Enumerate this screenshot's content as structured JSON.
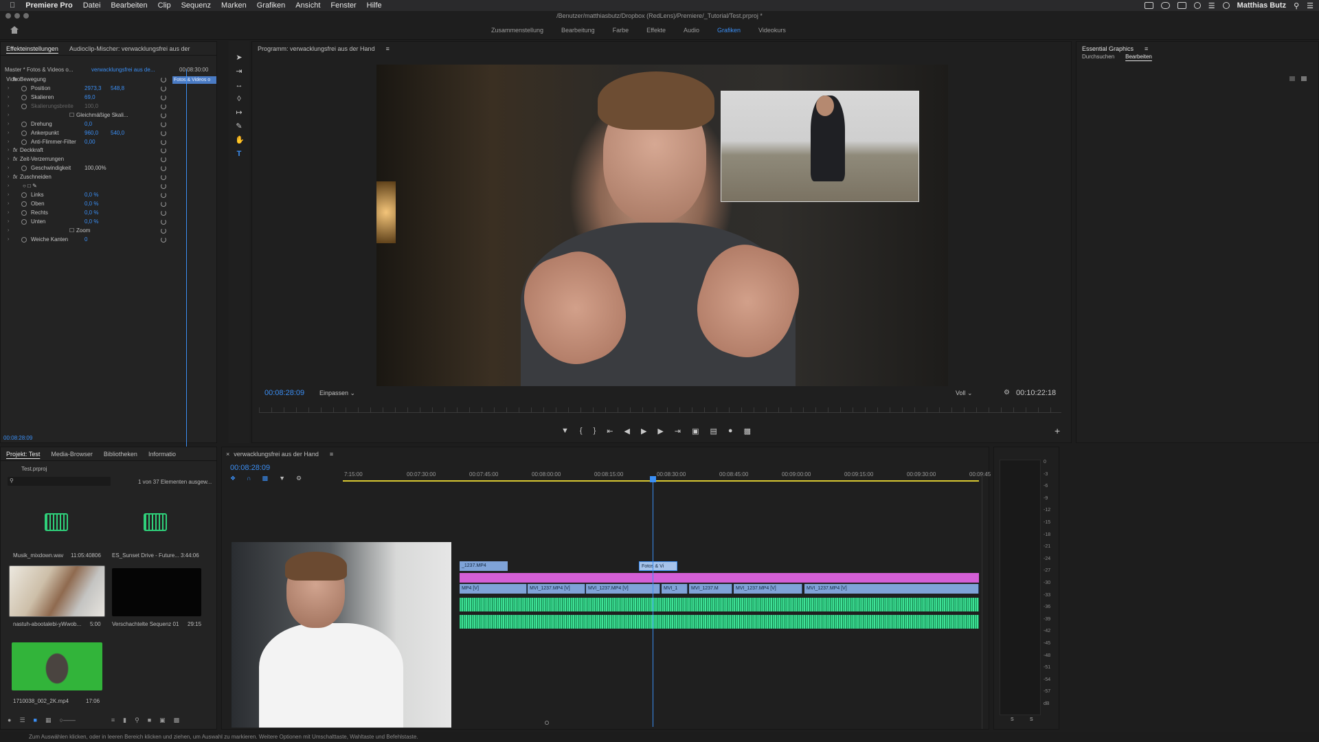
{
  "menubar": {
    "app": "Premiere Pro",
    "items": [
      "Datei",
      "Bearbeiten",
      "Clip",
      "Sequenz",
      "Marken",
      "Grafiken",
      "Ansicht",
      "Fenster",
      "Hilfe"
    ],
    "user": "Matthias Butz"
  },
  "titlebar": {
    "path": "/Benutzer/matthiasbutz/Dropbox (RedLens)/Premiere/_Tutorial/Test.prproj *"
  },
  "workspaces": {
    "tabs": [
      "Zusammenstellung",
      "Bearbeitung",
      "Farbe",
      "Effekte",
      "Audio",
      "Grafiken",
      "Videokurs"
    ],
    "active": "Grafiken"
  },
  "effects_panel": {
    "tabs": [
      "Effekteinstellungen",
      "Audioclip-Mischer: verwacklungsfrei aus der"
    ],
    "master": "Master * Fotos & Videos o...",
    "sequence": "verwacklungsfrei aus de...",
    "header_time": "00:08:30:00",
    "clip_label": "Fotos & Videos o",
    "section": "Video",
    "rows": [
      {
        "label": "Bewegung",
        "v1": "",
        "v2": "",
        "fx": true
      },
      {
        "label": "Position",
        "v1": "2973,3",
        "v2": "548,8"
      },
      {
        "label": "Skalieren",
        "v1": "69,0",
        "v2": ""
      },
      {
        "label": "Skalierungsbreite",
        "v1": "100,0",
        "v2": "",
        "dim": true
      },
      {
        "label": "Gleichmäßige Skali...",
        "v1": "",
        "v2": "",
        "checkbox": true
      },
      {
        "label": "Drehung",
        "v1": "0,0",
        "v2": ""
      },
      {
        "label": "Ankerpunkt",
        "v1": "960,0",
        "v2": "540,0"
      },
      {
        "label": "Anti-Flimmer-Filter",
        "v1": "0,00",
        "v2": ""
      },
      {
        "label": "Deckkraft",
        "v1": "",
        "v2": "",
        "fx": true
      },
      {
        "label": "Zeit-Verzerrungen",
        "v1": "",
        "v2": "",
        "fx": true
      },
      {
        "label": "Geschwindigkeit",
        "v1": "100,00%",
        "v2": "",
        "white": true
      },
      {
        "label": "Zuschneiden",
        "v1": "",
        "v2": "",
        "fx": true
      },
      {
        "label": "",
        "v1": "",
        "v2": "",
        "shapes": true
      },
      {
        "label": "Links",
        "v1": "0,0 %",
        "v2": ""
      },
      {
        "label": "Oben",
        "v1": "0,0 %",
        "v2": ""
      },
      {
        "label": "Rechts",
        "v1": "0,0 %",
        "v2": ""
      },
      {
        "label": "Unten",
        "v1": "0,0 %",
        "v2": ""
      },
      {
        "label": "Zoom",
        "v1": "",
        "v2": "",
        "checkbox": true
      },
      {
        "label": "Weiche Kanten",
        "v1": "0",
        "v2": ""
      }
    ],
    "footer_time": "00:08:28:09"
  },
  "program": {
    "title": "Programm: verwacklungsfrei aus der Hand",
    "timecode_left": "00:08:28:09",
    "fit": "Einpassen",
    "quality": "Voll",
    "timecode_right": "00:10:22:18"
  },
  "essential_graphics": {
    "title": "Essential Graphics",
    "tabs": [
      "Durchsuchen",
      "Bearbeiten"
    ],
    "active": "Bearbeiten"
  },
  "project": {
    "tabs": [
      "Projekt: Test",
      "Media-Browser",
      "Bibliotheken",
      "Informatio"
    ],
    "file": "Test.prproj",
    "count": "1 von 37 Elementen ausgew...",
    "items": [
      {
        "name": "Musik_mixdown.wav",
        "duration": "11:05:40806"
      },
      {
        "name": "ES_Sunset Drive - Future...",
        "duration": "3:44:06"
      },
      {
        "name": "nastuh-abootalebi-yWwob...",
        "duration": "5:00"
      },
      {
        "name": "Verschachtelte Sequenz 01",
        "duration": "29:15"
      },
      {
        "name": "1710038_002_2K.mp4",
        "duration": "17:06"
      }
    ]
  },
  "timeline": {
    "title": "verwacklungsfrei aus der Hand",
    "timecode": "00:08:28:09",
    "ruler": [
      "7:15:00",
      "00:07:30:00",
      "00:07:45:00",
      "00:08:00:00",
      "00:08:15:00",
      "00:08:30:00",
      "00:08:45:00",
      "00:09:00:00",
      "00:09:15:00",
      "00:09:30:00",
      "00:09:45"
    ],
    "clips_v3": [
      "_1237.MP4",
      "Fotos & Vi"
    ],
    "clips_v1": [
      "MP4 [V]",
      "MVI_1237.MP4 [V]",
      "MVI_1237.MP4 [V]",
      "MVI_1",
      "MVI_1237.M",
      "MVI_1237.MP4 [V]",
      "MVI_1237.MP4 [V]"
    ]
  },
  "meters": {
    "scale": [
      "0",
      "-3",
      "-6",
      "-9",
      "-12",
      "-15",
      "-18",
      "-21",
      "-24",
      "-27",
      "-30",
      "-33",
      "-36",
      "-39",
      "-42",
      "-45",
      "-48",
      "-51",
      "-54",
      "-57",
      "dB"
    ],
    "channels": [
      "S",
      "S"
    ]
  },
  "status": "Zum Auswählen klicken, oder in leeren Bereich klicken und ziehen, um Auswahl zu markieren. Weitere Optionen mit Umschalttaste, Wahltaste und Befehlstaste.",
  "colors": {
    "accent": "#3b8ff5",
    "audio": "#33d68a",
    "video_clip": "#7fa3d8",
    "adjust_clip": "#d45fd6"
  }
}
